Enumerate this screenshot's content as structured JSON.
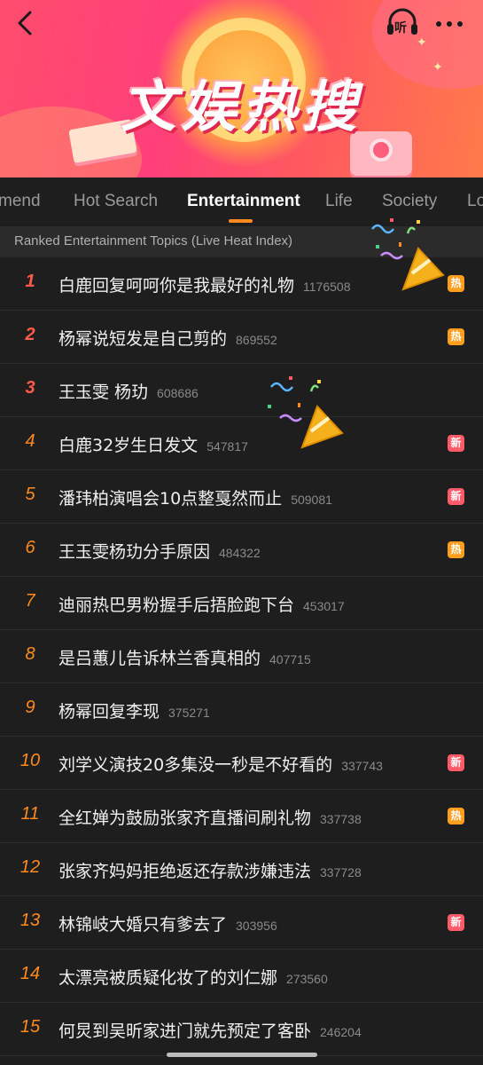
{
  "banner": {
    "title": "文娱热搜"
  },
  "header_icons": {
    "back": "chevron-left-icon",
    "listen": "headphones-listen-icon",
    "listen_label": "听",
    "more": "more-dots-icon"
  },
  "tabs": [
    {
      "label": "mend"
    },
    {
      "label": "Hot Search"
    },
    {
      "label": "Entertainment",
      "active": true
    },
    {
      "label": "Life"
    },
    {
      "label": "Society"
    },
    {
      "label": "Lo"
    }
  ],
  "section": {
    "label": "Ranked Entertainment Topics (Live Heat Index)"
  },
  "colors": {
    "accent": "#ff8a1f",
    "hot_badge": "#ff9d1c",
    "new_badge": "#ff5a6a",
    "background": "#1e1e1e"
  },
  "items": [
    {
      "rank": "1",
      "title": "白鹿回复呵呵你是我最好的礼物",
      "heat": "1176508",
      "badge": "热"
    },
    {
      "rank": "2",
      "title": "杨幂说短发是自己剪的",
      "heat": "869552",
      "badge": "热"
    },
    {
      "rank": "3",
      "title": "王玉雯 杨玏",
      "heat": "608686",
      "badge": ""
    },
    {
      "rank": "4",
      "title": "白鹿32岁生日发文",
      "heat": "547817",
      "badge": "新"
    },
    {
      "rank": "5",
      "title": "潘玮柏演唱会10点整戛然而止",
      "heat": "509081",
      "badge": "新"
    },
    {
      "rank": "6",
      "title": "王玉雯杨玏分手原因",
      "heat": "484322",
      "badge": "热"
    },
    {
      "rank": "7",
      "title": "迪丽热巴男粉握手后捂脸跑下台",
      "heat": "453017",
      "badge": ""
    },
    {
      "rank": "8",
      "title": "是吕蕙儿告诉林兰香真相的",
      "heat": "407715",
      "badge": ""
    },
    {
      "rank": "9",
      "title": "杨幂回复李现",
      "heat": "375271",
      "badge": ""
    },
    {
      "rank": "10",
      "title": "刘学义演技20多集没一秒是不好看的",
      "heat": "337743",
      "badge": "新"
    },
    {
      "rank": "11",
      "title": "全红婵为鼓励张家齐直播间刷礼物",
      "heat": "337738",
      "badge": "热"
    },
    {
      "rank": "12",
      "title": "张家齐妈妈拒绝返还存款涉嫌违法",
      "heat": "337728",
      "badge": ""
    },
    {
      "rank": "13",
      "title": "林锦岐大婚只有爹去了",
      "heat": "303956",
      "badge": "新"
    },
    {
      "rank": "14",
      "title": "太漂亮被质疑化妆了的刘仁娜",
      "heat": "273560",
      "badge": ""
    },
    {
      "rank": "15",
      "title": "何炅到吴昕家进门就先预定了客卧",
      "heat": "246204",
      "badge": ""
    }
  ]
}
